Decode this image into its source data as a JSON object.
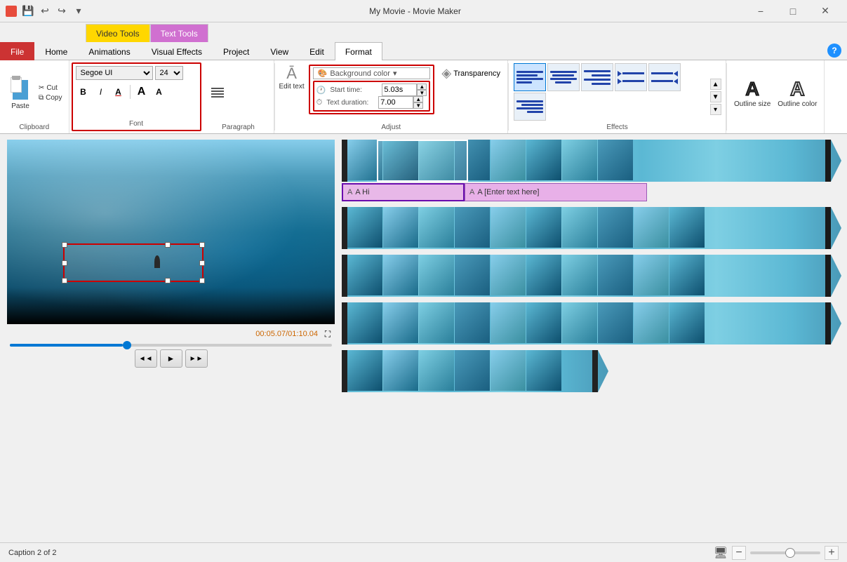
{
  "window": {
    "title": "My Movie - Movie Maker",
    "min_label": "−",
    "max_label": "□",
    "close_label": "✕"
  },
  "ribbon_tabs": {
    "file": "File",
    "home": "Home",
    "animations": "Animations",
    "visual_effects": "Visual Effects",
    "project": "Project",
    "view": "View",
    "edit": "Edit",
    "video_tools": "Video Tools",
    "text_tools": "Text Tools",
    "format": "Format"
  },
  "clipboard": {
    "paste": "Paste",
    "cut": "Cut",
    "copy": "Copy",
    "group_label": "Clipboard"
  },
  "font": {
    "font_name": "Segoe UI",
    "font_size": "24",
    "bold": "B",
    "italic": "I",
    "font_color": "A",
    "grow": "A",
    "shrink": "A",
    "group_label": "Font"
  },
  "paragraph": {
    "align_left": "≡",
    "align_center": "≡",
    "align_right": "≡",
    "group_label": "Paragraph"
  },
  "adjust": {
    "transparency": "Transparency",
    "edit_text": "Edit\ntext",
    "bg_color": "Background color",
    "start_time_label": "Start time:",
    "start_time_value": "5.03s",
    "text_duration_label": "Text duration:",
    "text_duration_value": "7.00",
    "group_label": "Adjust"
  },
  "effects": {
    "group_label": "Effects",
    "items": [
      {
        "id": "e1",
        "active": true
      },
      {
        "id": "e2",
        "active": false
      },
      {
        "id": "e3",
        "active": false
      },
      {
        "id": "e4",
        "active": false
      },
      {
        "id": "e5",
        "active": false
      },
      {
        "id": "e6",
        "active": false
      },
      {
        "id": "e7",
        "active": false
      },
      {
        "id": "e8",
        "active": false
      }
    ]
  },
  "outline": {
    "size_label": "Outline\nsize",
    "color_label": "Outline\ncolor"
  },
  "timeline": {
    "caption1": "A Hi",
    "caption2": "A [Enter text here]"
  },
  "player": {
    "time_display": "00:05.07/01:10.04",
    "rewind": "◄◄",
    "play": "►",
    "fastforward": "►►"
  },
  "statusbar": {
    "status": "Caption 2 of 2",
    "zoom_out": "−",
    "zoom_in": "+"
  }
}
